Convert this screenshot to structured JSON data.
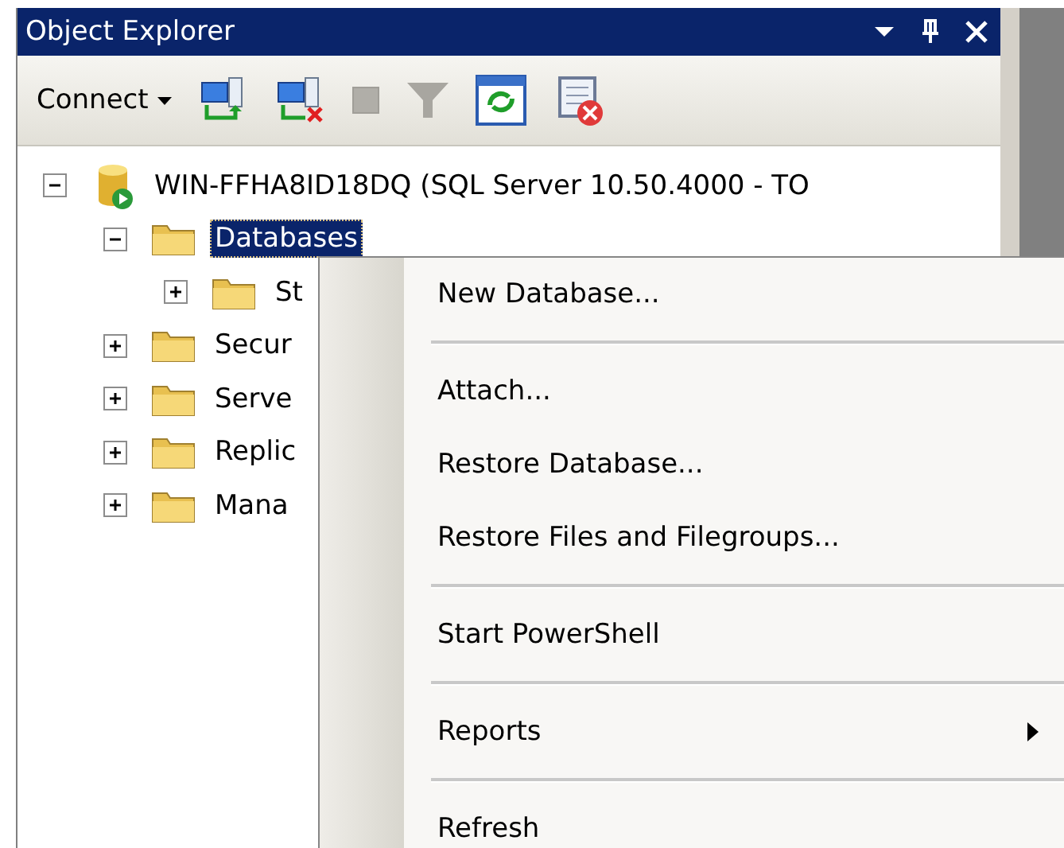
{
  "panel": {
    "title": "Object Explorer"
  },
  "toolbar": {
    "connect_label": "Connect"
  },
  "tree": [
    {
      "kind": "server",
      "label": "WIN-FFHA8ID18DQ (SQL Server 10.50.4000 - TO",
      "expanded": true,
      "selected": false,
      "children": [
        {
          "kind": "folder",
          "label": "Databases",
          "expanded": true,
          "selected": true,
          "children": [
            {
              "kind": "folder",
              "label": "St",
              "expanded": false,
              "selected": false
            }
          ]
        },
        {
          "kind": "folder",
          "label": "Secur",
          "expanded": false,
          "selected": false
        },
        {
          "kind": "folder",
          "label": "Serve",
          "expanded": false,
          "selected": false
        },
        {
          "kind": "folder",
          "label": "Replic",
          "expanded": false,
          "selected": false
        },
        {
          "kind": "folder",
          "label": "Mana",
          "expanded": false,
          "selected": false
        }
      ]
    }
  ],
  "context_menu": [
    {
      "kind": "item",
      "label": "New Database..."
    },
    {
      "kind": "separator"
    },
    {
      "kind": "item",
      "label": "Attach..."
    },
    {
      "kind": "item",
      "label": "Restore Database..."
    },
    {
      "kind": "item",
      "label": "Restore Files and Filegroups..."
    },
    {
      "kind": "separator"
    },
    {
      "kind": "item",
      "label": "Start PowerShell"
    },
    {
      "kind": "separator"
    },
    {
      "kind": "submenu",
      "label": "Reports"
    },
    {
      "kind": "separator"
    },
    {
      "kind": "item",
      "label": "Refresh"
    }
  ]
}
